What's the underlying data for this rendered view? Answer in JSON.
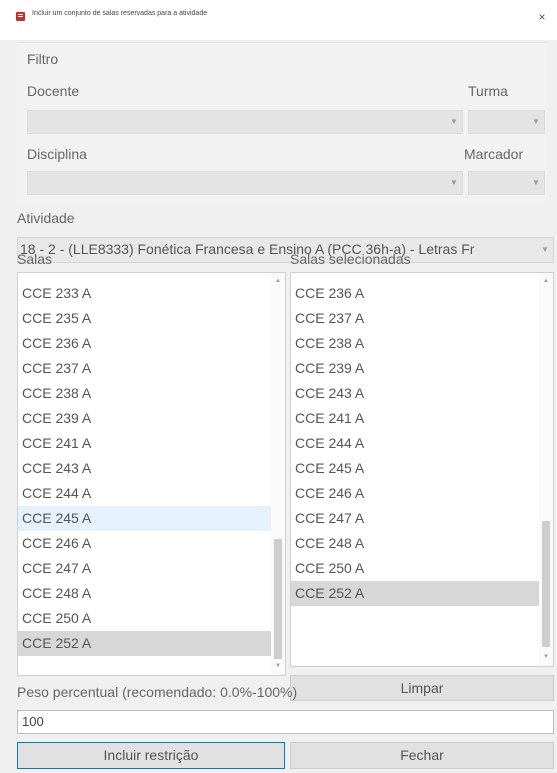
{
  "window": {
    "title": "Incluir um conjunto de salas reservadas para a atividade",
    "close_glyph": "×"
  },
  "filter": {
    "group_label": "Filtro",
    "docente_label": "Docente",
    "turma_label": "Turma",
    "disciplina_label": "Disciplina",
    "marcador_label": "Marcador",
    "docente_value": "",
    "turma_value": "",
    "disciplina_value": "",
    "marcador_value": ""
  },
  "activity": {
    "label": "Atividade",
    "value": "18 - 2 - (LLE8333) Fonética Francesa e Ensino A (PCC 36h-a) - Letras Fr"
  },
  "rooms": {
    "label": "Salas",
    "items": [
      "CCE 233 A",
      "CCE 235 A",
      "CCE 236 A",
      "CCE 237 A",
      "CCE 238 A",
      "CCE 239 A",
      "CCE 241 A",
      "CCE 243 A",
      "CCE 244 A",
      "CCE 245 A",
      "CCE 246 A",
      "CCE 247 A",
      "CCE 248 A",
      "CCE 250 A",
      "CCE 252 A"
    ],
    "hovered": "CCE 245 A",
    "selected": "CCE 252 A"
  },
  "selected_rooms": {
    "label": "Salas selecionadas",
    "items": [
      "CCE 236 A",
      "CCE 237 A",
      "CCE 238 A",
      "CCE 239 A",
      "CCE 243 A",
      "CCE 241 A",
      "CCE 244 A",
      "CCE 245 A",
      "CCE 246 A",
      "CCE 247 A",
      "CCE 248 A",
      "CCE 250 A",
      "CCE 252 A"
    ],
    "selected": "CCE 252 A",
    "clear_label": "Limpar"
  },
  "weight": {
    "label": "Peso percentual (recomendado: 0.0%-100%)",
    "value": "100"
  },
  "actions": {
    "include_label": "Incluir restrição",
    "close_label": "Fechar"
  },
  "colors": {
    "window_bg": "#f0f0f0",
    "primary_border": "#0078d7",
    "hover_row": "#e5f1fb",
    "selected_row": "#d7d7d7"
  }
}
